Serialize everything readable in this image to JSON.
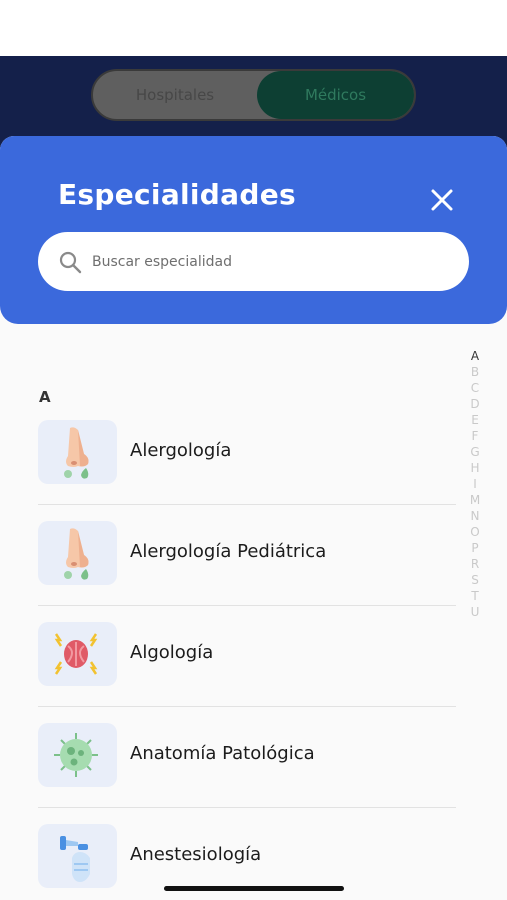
{
  "segmented": {
    "hospitals_label": "Hospitales",
    "doctors_label": "Médicos"
  },
  "sheet": {
    "title": "Especialidades",
    "search_placeholder": "Buscar especialidad"
  },
  "section_letter": "A",
  "items": [
    {
      "label": "Alergología",
      "icon": "nose-icon"
    },
    {
      "label": "Alergología Pediátrica",
      "icon": "nose-icon"
    },
    {
      "label": "Algología",
      "icon": "pain-icon"
    },
    {
      "label": "Anatomía Patológica",
      "icon": "cell-icon"
    },
    {
      "label": "Anestesiología",
      "icon": "anesthesia-mask-icon"
    }
  ],
  "alphabet_index": [
    "A",
    "B",
    "C",
    "D",
    "E",
    "F",
    "G",
    "H",
    "I",
    "M",
    "N",
    "O",
    "P",
    "R",
    "S",
    "T",
    "U"
  ],
  "active_index_letter": "A",
  "colors": {
    "header_blue": "#3b69dc",
    "nav_dark": "#14204a",
    "thumb_bg": "#e9eef9"
  }
}
